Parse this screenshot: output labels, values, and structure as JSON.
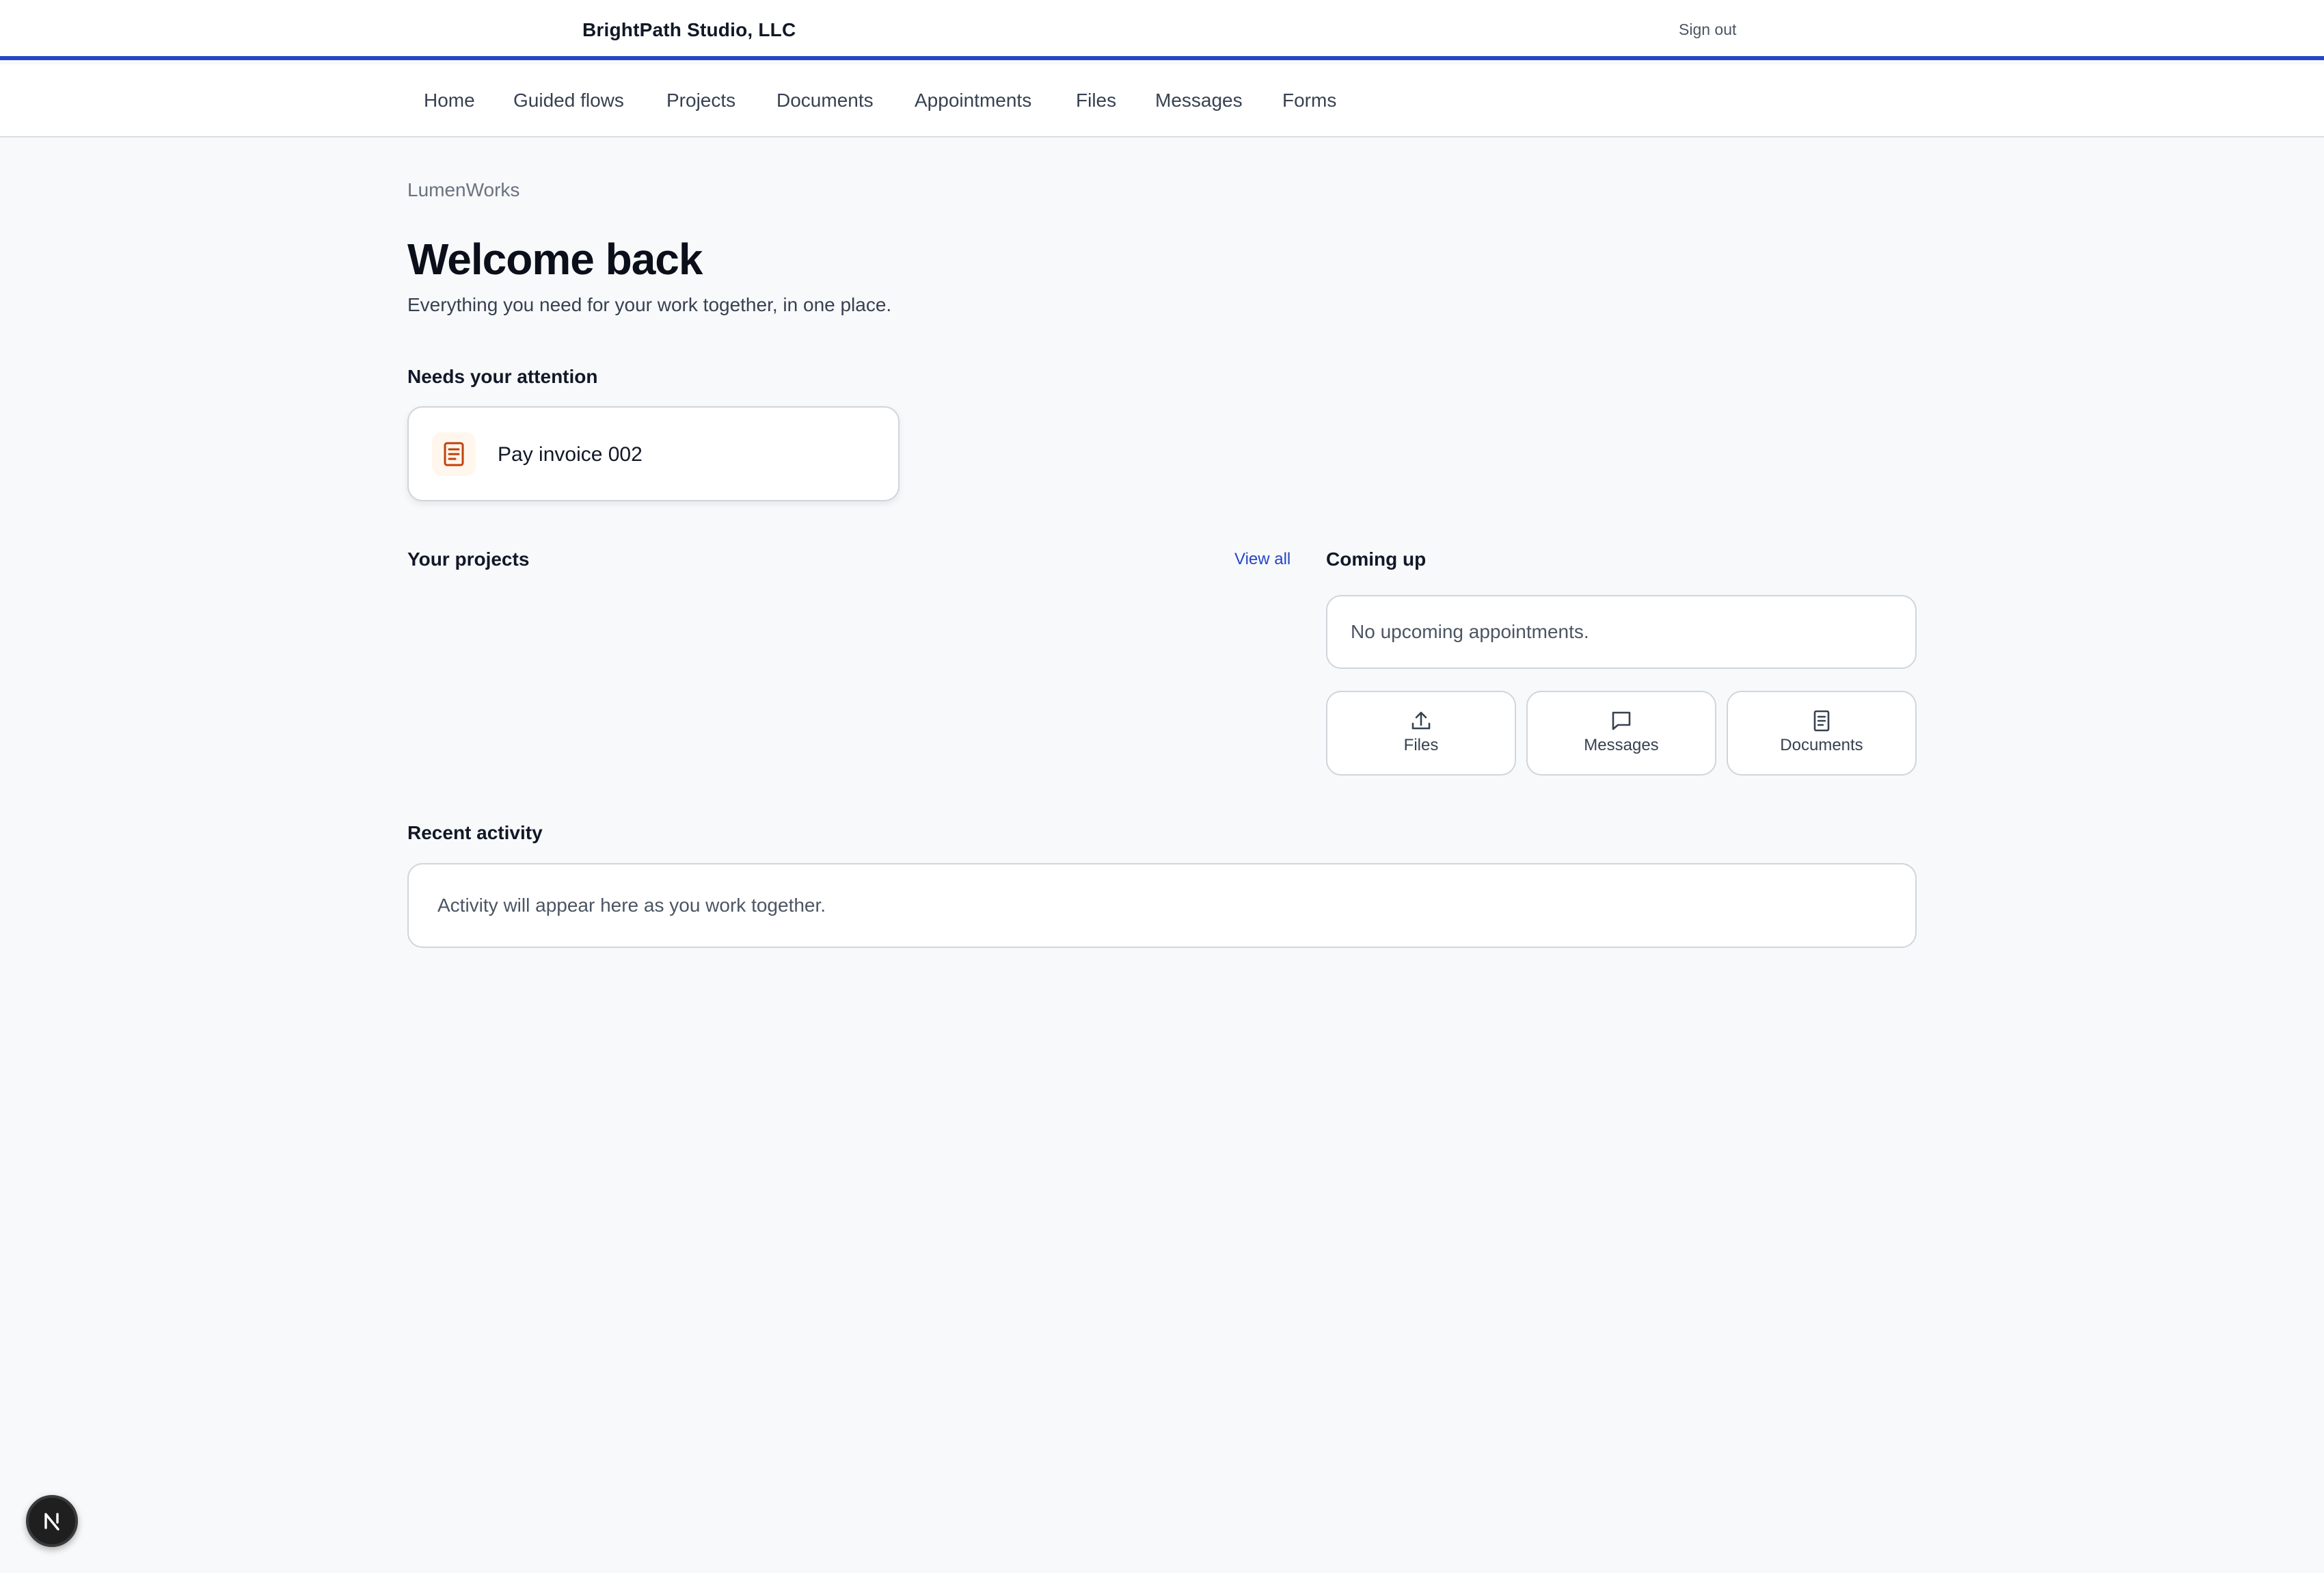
{
  "header": {
    "brand": "BrightPath Studio, LLC",
    "sign_out": "Sign out",
    "accent_color": "#2446c8"
  },
  "nav": {
    "items": [
      "Home",
      "Guided flows",
      "Projects",
      "Documents",
      "Appointments",
      "Files",
      "Messages",
      "Forms"
    ]
  },
  "main": {
    "breadcrumb": "LumenWorks",
    "title": "Welcome back",
    "subtitle": "Everything you need for your work together, in one place.",
    "attention": {
      "heading": "Needs your attention",
      "items": [
        {
          "label": "Pay invoice 002",
          "icon": "receipt-icon",
          "icon_color": "#c2410c"
        }
      ]
    },
    "projects": {
      "heading": "Your projects",
      "view_all": "View all"
    },
    "coming_up": {
      "heading": "Coming up",
      "empty_text": "No upcoming appointments.",
      "quick_links": [
        {
          "label": "Files",
          "icon": "upload-icon"
        },
        {
          "label": "Messages",
          "icon": "message-icon"
        },
        {
          "label": "Documents",
          "icon": "document-icon"
        }
      ]
    },
    "activity": {
      "heading": "Recent activity",
      "empty_text": "Activity will appear here as you work together."
    }
  },
  "badge": {
    "letter": "N",
    "icon": "next-logo-icon"
  }
}
